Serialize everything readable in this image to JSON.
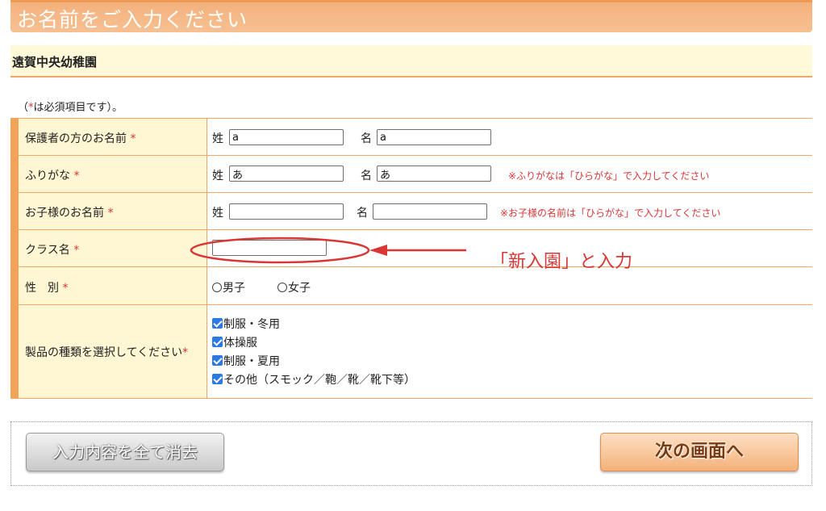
{
  "header": {
    "title": "お名前をご入力ください"
  },
  "school": {
    "name": "遠賀中央幼稚園"
  },
  "note": {
    "prefix": "（",
    "star": "*",
    "suffix": "は必須項目です）。"
  },
  "required_mark": "*",
  "rows": {
    "guardian": {
      "label": "保護者の方のお名前",
      "last_label": "姓",
      "last_value": "a",
      "first_label": "名",
      "first_value": "a"
    },
    "furigana": {
      "label": "ふりがな",
      "last_label": "姓",
      "last_value": "あ",
      "first_label": "名",
      "first_value": "あ",
      "hint": "※ふりがなは「ひらがな」で入力してください"
    },
    "child": {
      "label": "お子様のお名前",
      "last_label": "姓",
      "last_value": "",
      "first_label": "名",
      "first_value": "",
      "hint": "※お子様の名前は「ひらがな」で入力してください"
    },
    "class": {
      "label": "クラス名",
      "value": ""
    },
    "gender": {
      "label": "性　別",
      "options": [
        "男子",
        "女子"
      ],
      "selected": null
    },
    "products": {
      "label": "製品の種類を選択してください",
      "options": [
        {
          "label": "制服・冬用",
          "checked": true
        },
        {
          "label": "体操服",
          "checked": true
        },
        {
          "label": "制服・夏用",
          "checked": true
        },
        {
          "label": "その他（スモック／鞄／靴／靴下等）",
          "checked": true
        }
      ]
    }
  },
  "annotation": {
    "text": "「新入園」と入力",
    "color": "#d93636"
  },
  "buttons": {
    "clear": "入力内容を全て消去",
    "next": "次の画面へ"
  },
  "colors": {
    "accent": "#f2a35a",
    "label_bg": "#fff6d3",
    "required": "#d93636"
  }
}
